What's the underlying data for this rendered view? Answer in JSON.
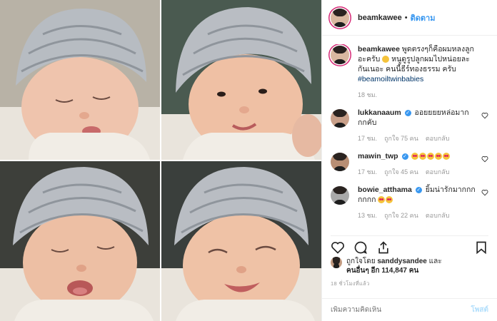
{
  "post": {
    "username": "beamkawee",
    "follow_label": "ติดตาม",
    "dot": "•"
  },
  "caption": {
    "username": "beamkawee",
    "text_part1": "พูดตรงๆก็คือผมหลงลูกอะครับ",
    "text_part2": "หนูดูรูปลูกผมไปหน่อยละกันเนอะ คนนี้ธีร์ทองธรรม ครับ",
    "hashtag": "#beamoiltwinbabies",
    "time": "18 ชม."
  },
  "comments": [
    {
      "username": "lukkanaaum",
      "text": "ออยยยยหล่อมากกกคับ",
      "time": "17 ชม.",
      "likes": "ถูกใจ 75 คน",
      "reply": "ตอบกลับ"
    },
    {
      "username": "mawin_twp",
      "text": "",
      "emoji_count": 5,
      "time": "17 ชม.",
      "likes": "ถูกใจ 45 คน",
      "reply": "ตอบกลับ"
    },
    {
      "username": "bowie_atthama",
      "text": "ยิ้มน่ารักมากกกกกกก",
      "emoji_count": 2,
      "time": "13 ชม.",
      "likes": "ถูกใจ 22 คน",
      "reply": "ตอบกลับ"
    }
  ],
  "likes": {
    "prefix": "ถูกใจโดย",
    "user": "sanddysandee",
    "and": "และ",
    "others": "คนอื่นๆ อีก 114,847 คน"
  },
  "timestamp": "18 ชั่วโมงที่แล้ว",
  "add_comment": {
    "placeholder": "เพิ่มความคิดเห็น",
    "post_label": "โพสต์"
  },
  "icons": {
    "heart": "heart-icon",
    "comment": "comment-icon",
    "share": "share-icon",
    "save": "bookmark-icon"
  },
  "colors": {
    "link_blue": "#3897f0",
    "post_disabled": "#b2dffc",
    "verified": "#3897f0",
    "text": "#262626",
    "muted": "#999999"
  }
}
